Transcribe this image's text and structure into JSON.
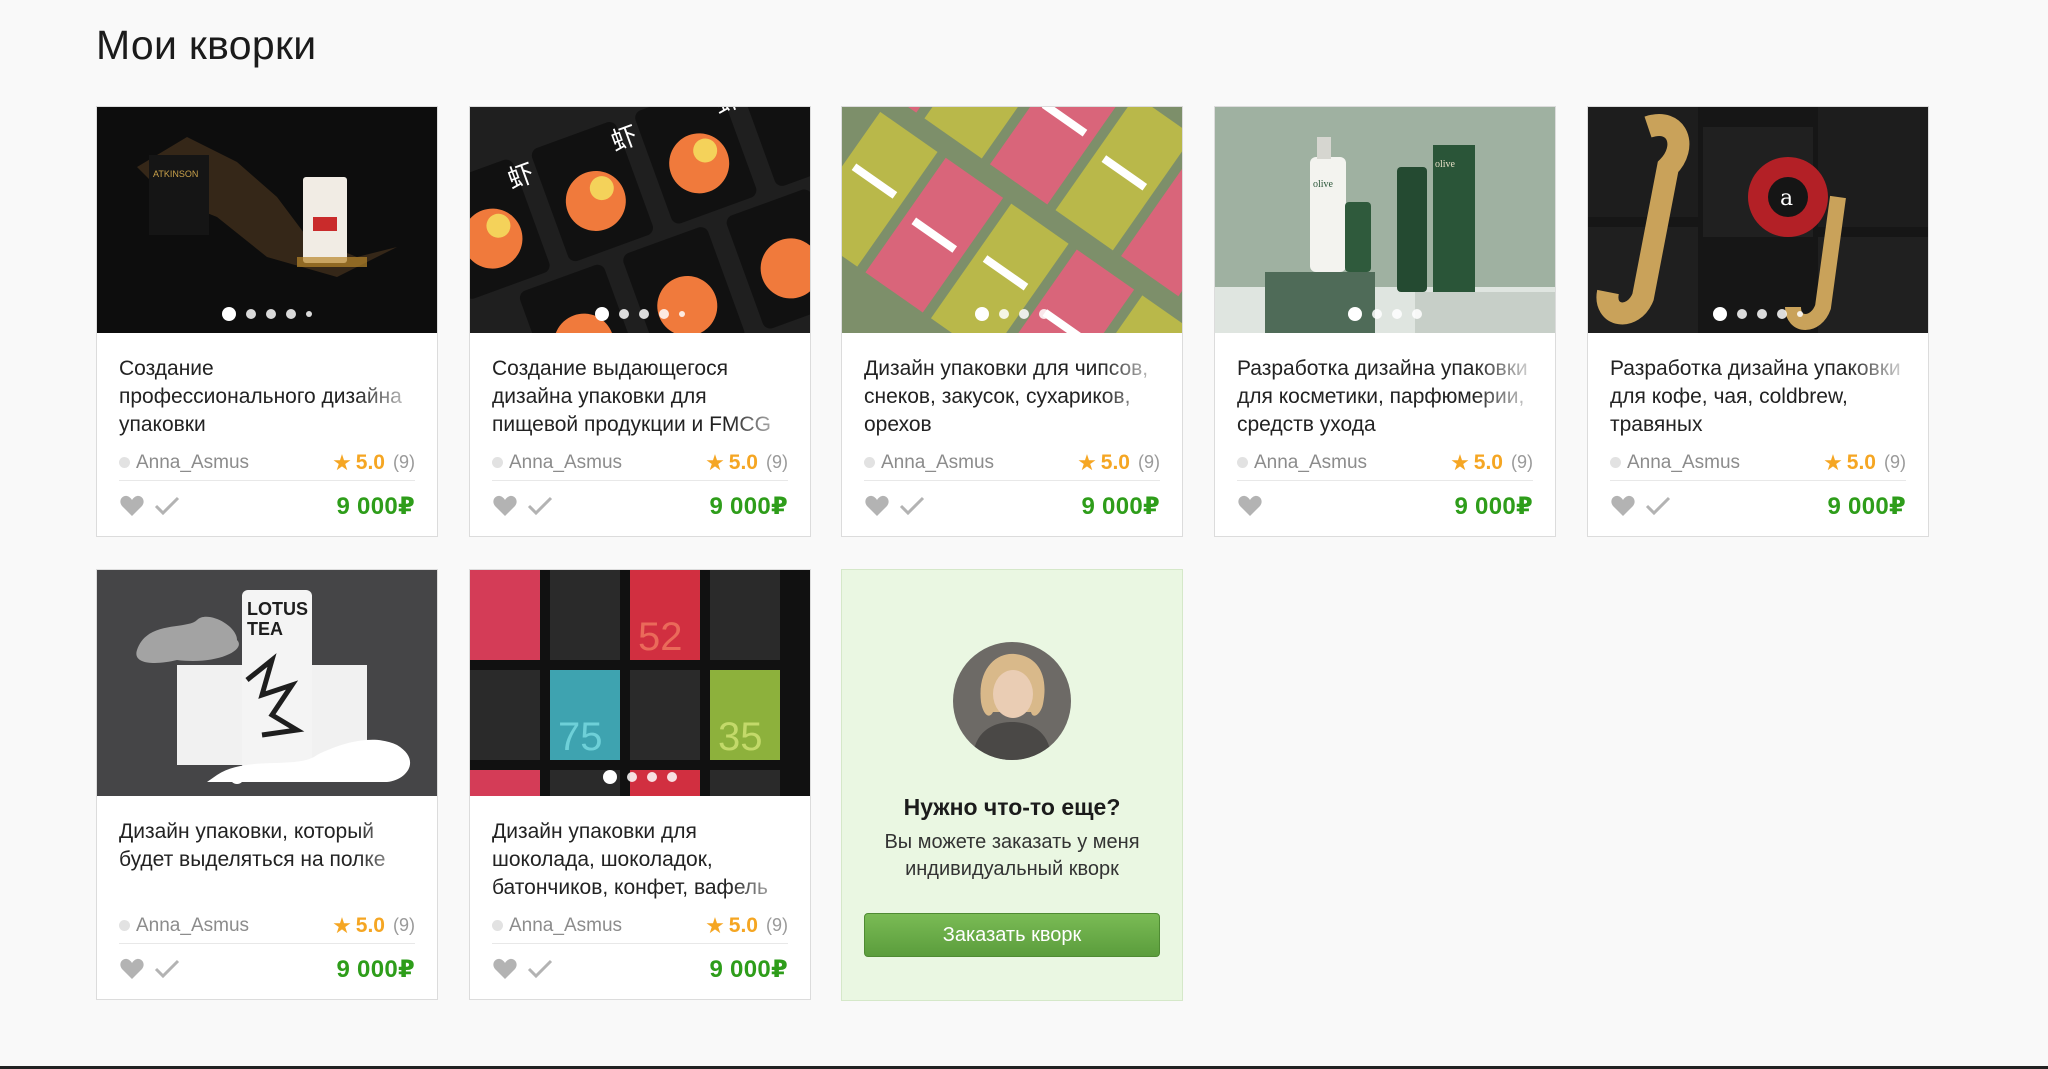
{
  "page": {
    "title": "Мои кворки"
  },
  "cards": [
    {
      "title": "Создание профессионального дизайна упаковки",
      "author": "Anna_Asmus",
      "rating": "5.0",
      "reviews": "(9)",
      "price": "9 000₽",
      "icons": [
        "heart-icon",
        "check-icon"
      ]
    },
    {
      "title": "Создание выдающегося дизайна упаковки для пищевой продукции и FMCG",
      "author": "Anna_Asmus",
      "rating": "5.0",
      "reviews": "(9)",
      "price": "9 000₽",
      "icons": [
        "heart-icon",
        "check-icon"
      ]
    },
    {
      "title": "Дизайн упаковки для чипсов, снеков, закусок, сухариков, орехов",
      "author": "Anna_Asmus",
      "rating": "5.0",
      "reviews": "(9)",
      "price": "9 000₽",
      "icons": [
        "heart-icon",
        "check-icon"
      ]
    },
    {
      "title": "Разработка дизайна упаковки для косметики, парфюмерии, средств ухода",
      "author": "Anna_Asmus",
      "rating": "5.0",
      "reviews": "(9)",
      "price": "9 000₽",
      "icons": [
        "heart-icon"
      ]
    },
    {
      "title": "Разработка дизайна упаковки для кофе, чая, coldbrew, травяных",
      "author": "Anna_Asmus",
      "rating": "5.0",
      "reviews": "(9)",
      "price": "9 000₽",
      "icons": [
        "heart-icon",
        "check-icon"
      ]
    },
    {
      "title": "Дизайн упаковки, который будет выделяться на полке",
      "author": "Anna_Asmus",
      "rating": "5.0",
      "reviews": "(9)",
      "price": "9 000₽",
      "icons": [
        "heart-icon",
        "check-icon"
      ]
    },
    {
      "title": "Дизайн упаковки для шоколада, шоколадок, батончиков, конфет, вафель",
      "author": "Anna_Asmus",
      "rating": "5.0",
      "reviews": "(9)",
      "price": "9 000₽",
      "icons": [
        "heart-icon",
        "check-icon"
      ]
    }
  ],
  "promo": {
    "heading": "Нужно что-то еще?",
    "text": "Вы можете заказать у меня индивидуальный кворк",
    "button_label": "Заказать кворк"
  },
  "colors": {
    "price": "#2e9d1a",
    "star": "#f5a623",
    "promo_bg": "#eaf7e2",
    "button": "#6aad48"
  }
}
